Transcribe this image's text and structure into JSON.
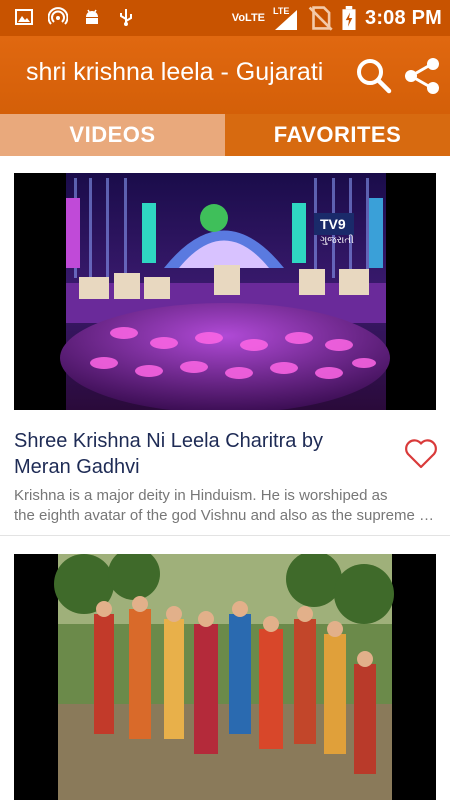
{
  "status_bar": {
    "network_label": "VoLTE",
    "lte_label": "LTE",
    "time": "3:08 PM"
  },
  "app_bar": {
    "title": "shri krishna leela - Gujarati",
    "search_icon": "search-icon",
    "share_icon": "share-icon"
  },
  "tabs": [
    {
      "label": "VIDEOS",
      "selected": false
    },
    {
      "label": "FAVORITES",
      "selected": true
    }
  ],
  "videos": [
    {
      "title_line1": "Shree Krishna Ni Leela Charitra by",
      "title_line2": "Meran Gadhvi",
      "desc_line1": "Krishna is a major deity in Hinduism. He is worshiped as",
      "desc_line2": "the eighth avatar of the god Vishnu and also as the supreme god in his own right.",
      "thumbnail_logo": "TV9",
      "thumbnail_logo_sub": "ગુજરાતી",
      "favorite": false
    },
    {
      "title_line1": "",
      "title_line2": "",
      "desc_line1": "",
      "desc_line2": "",
      "favorite": false
    }
  ],
  "colors": {
    "status_bar": "#c85300",
    "app_bar": "#d96409",
    "tab_selected": "#d76a10",
    "tab_unselected": "#e9a97c",
    "title_text": "#1e2b55",
    "heart": "#d93a3a"
  }
}
